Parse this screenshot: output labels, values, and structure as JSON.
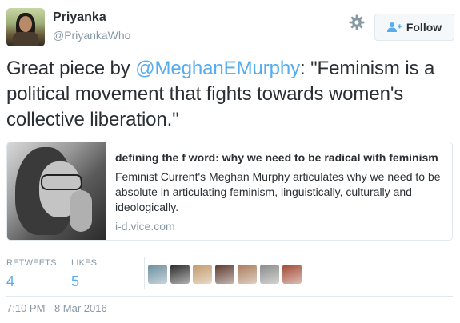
{
  "user": {
    "display_name": "Priyanka",
    "handle": "@PriyankaWho",
    "avatar_icon": "user-avatar"
  },
  "actions": {
    "settings_icon": "gear-icon",
    "follow_label": "Follow",
    "follow_icon": "add-user-icon"
  },
  "tweet": {
    "text_before": "Great piece by ",
    "mention": "@MeghanEMurphy",
    "text_after": ": \"Feminism is a political movement that fights towards women's collective liberation.\""
  },
  "card": {
    "title": "defining the f word: why we need to be radical with feminism",
    "description": "Feminist Current's Meghan Murphy articulates why we need to be absolute in articulating feminism, linguistically, culturally and ideologically.",
    "domain": "i-d.vice.com"
  },
  "stats": {
    "retweets_label": "RETWEETS",
    "retweets_count": "4",
    "likes_label": "LIKES",
    "likes_count": "5"
  },
  "likers": [
    {
      "color": "#6b8e9e",
      "icon": "liker-avatar"
    },
    {
      "color": "#2b2b2b",
      "icon": "liker-avatar"
    },
    {
      "color": "#c29a6b",
      "icon": "liker-avatar"
    },
    {
      "color": "#5d3a2e",
      "icon": "liker-avatar"
    },
    {
      "color": "#a97c5a",
      "icon": "liker-avatar"
    },
    {
      "color": "#8a8a8a",
      "icon": "liker-avatar"
    },
    {
      "color": "#a14a34",
      "icon": "liker-avatar"
    }
  ],
  "timestamp": "7:10 PM - 8 Mar 2016",
  "colors": {
    "accent": "#55acee",
    "text": "#292f33",
    "muted": "#8899a6",
    "border": "#e1e8ed"
  }
}
